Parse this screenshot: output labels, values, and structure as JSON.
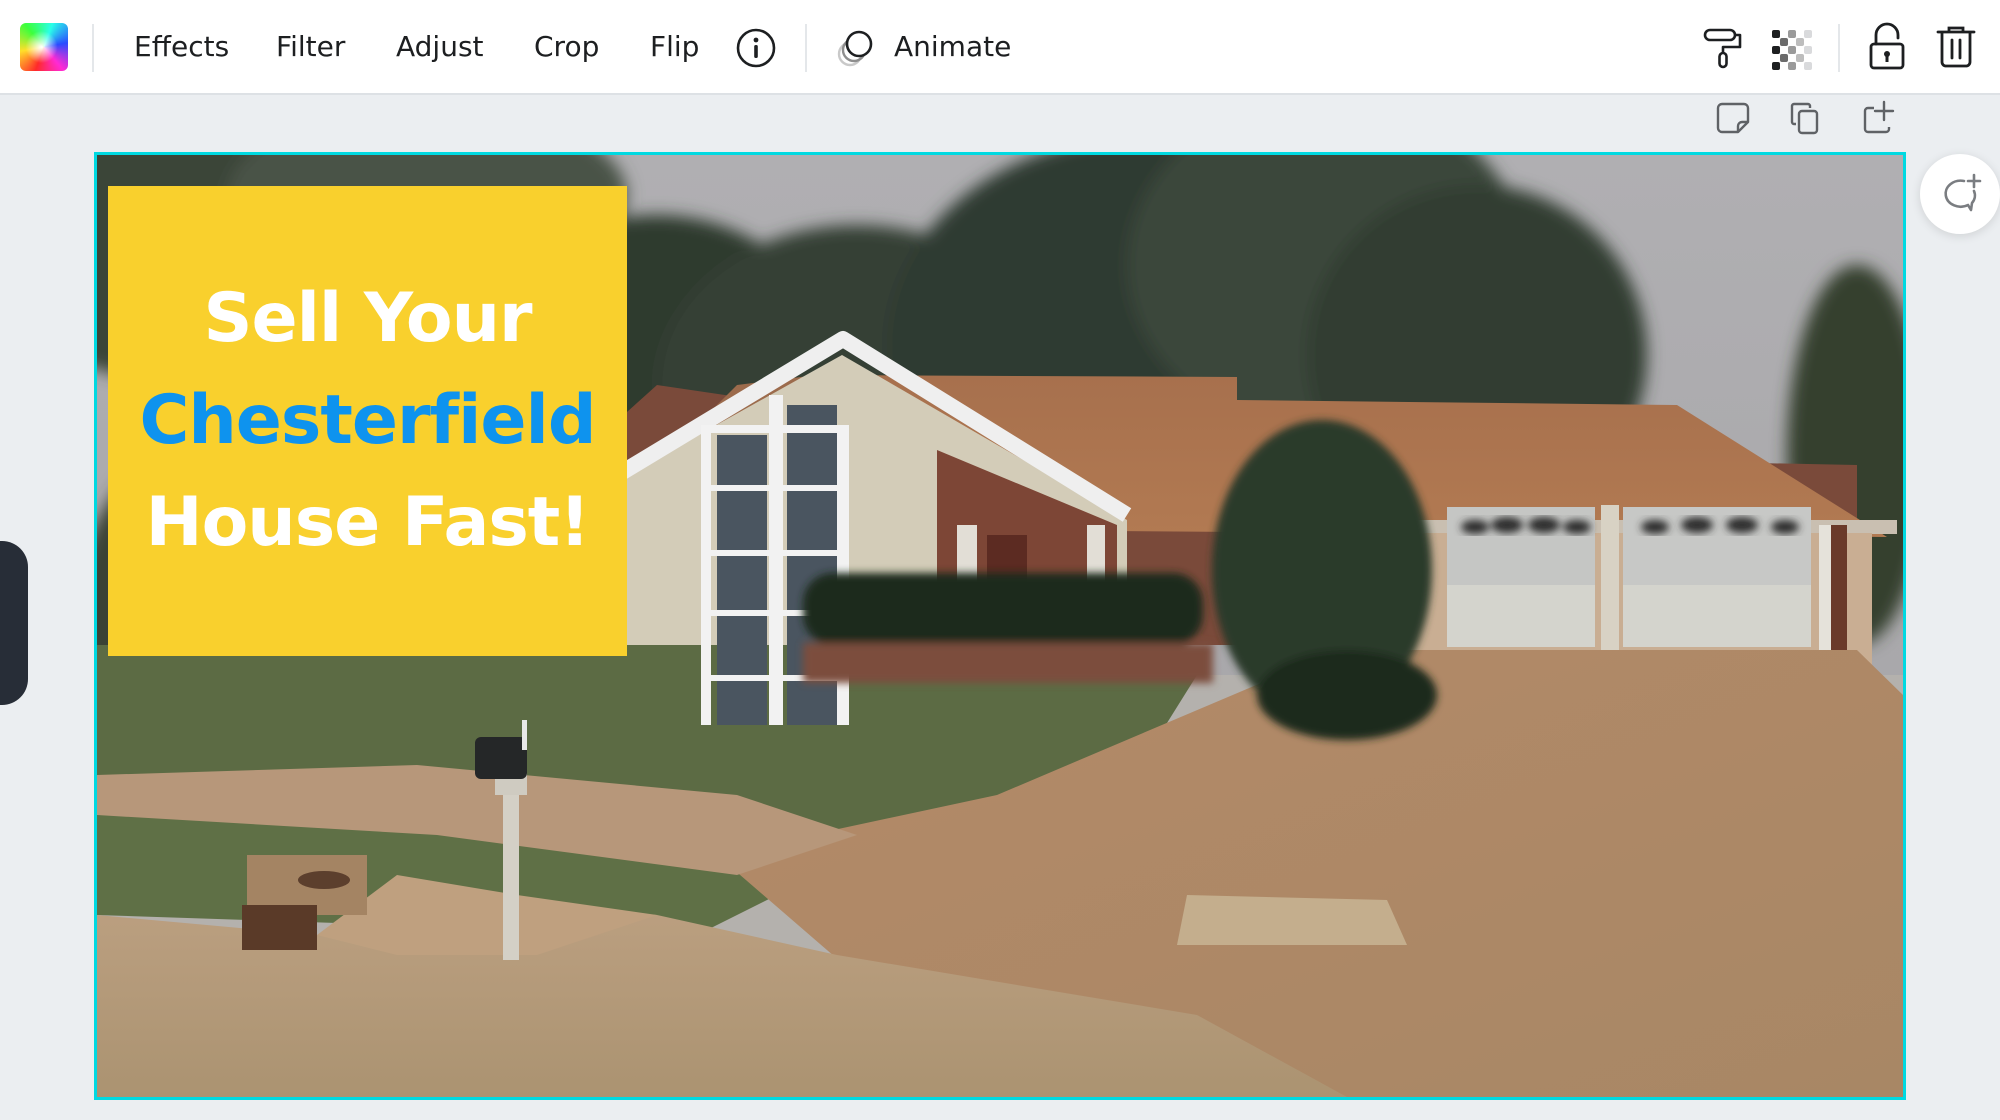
{
  "toolbar": {
    "logo_icon": "color-palette-icon",
    "buttons": [
      {
        "label": "Effects"
      },
      {
        "label": "Filter"
      },
      {
        "label": "Adjust"
      },
      {
        "label": "Crop"
      },
      {
        "label": "Flip"
      }
    ],
    "info_icon": "info-icon",
    "animate": {
      "label": "Animate",
      "icon": "animate-icon"
    },
    "right_icons": [
      "paint-roller-icon",
      "transparency-icon",
      "unlock-icon",
      "trash-icon"
    ]
  },
  "page_actions": {
    "icons": [
      "add-note-icon",
      "duplicate-page-icon",
      "add-page-icon"
    ]
  },
  "canvas": {
    "selected_border_color": "#00D9E1",
    "headline": {
      "lines": [
        "Sell Your",
        "Chesterfield",
        "House Fast!"
      ],
      "box_color": "#F9D02D",
      "text_color": "#FFFFFF",
      "accent_color": "#0E93EE"
    },
    "photo_description": "Street view of a ranch-style house with a steep A-frame gable, large windows, a two-car garage, round shrub, lawn, mailbox and driveway"
  },
  "comment_button": {
    "icon": "add-comment-icon"
  }
}
